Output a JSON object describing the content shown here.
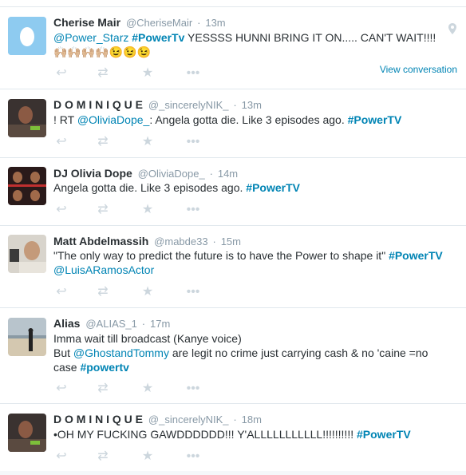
{
  "tweets": [
    {
      "fullname": "Cherise Mair",
      "username": "@CheriseMair",
      "time": "13m",
      "mention1": "@Power_Starz",
      "hashtag1": "#PowerTv",
      "text1": " YESSSS HUNNI BRING IT ON..... CAN'T WAIT!!!! ",
      "emoji_line": "🙌🏼🙌🏼🙌🏼🙌🏼😉😉😉",
      "view_conversation": "View conversation",
      "avatar": "default-egg-avatar",
      "geo_icon": "location-pin-icon"
    },
    {
      "fullname": "D O M I N I Q U E",
      "username": "@_sincerelyNIK_",
      "time": "13m",
      "prefix": "! RT ",
      "mention1": "@OliviaDope_",
      "text1": ": Angela gotta die. Like 3 episodes ago. ",
      "hashtag1": "#PowerTV"
    },
    {
      "fullname": "DJ Olivia Dope",
      "username": "@OliviaDope_",
      "time": "14m",
      "text1": "Angela gotta die. Like 3 episodes ago. ",
      "hashtag1": "#PowerTV"
    },
    {
      "fullname": "Matt Abdelmassih",
      "username": "@mabde33",
      "time": "15m",
      "text1": "\"The only way to predict the future is to have the Power to shape it\" ",
      "hashtag1": "#PowerTV",
      "mention1": "@LuisARamosActor"
    },
    {
      "fullname": "Alias",
      "username": "@ALIAS_1",
      "time": "17m",
      "text1": "Imma wait till broadcast (Kanye voice)",
      "prefix2": "But ",
      "mention1": "@GhostandTommy",
      "text2": " are legit no crime just carrying cash & no 'caine =no case ",
      "hashtag1": "#powertv"
    },
    {
      "fullname": "D O M I N I Q U E",
      "username": "@_sincerelyNIK_",
      "time": "18m",
      "text1": "•OH MY FUCKING GAWDDDDDD!!! Y'ALLLLLLLLLLL!!!!!!!!!! ",
      "hashtag1": "#PowerTV"
    }
  ],
  "separator": "·",
  "action_icons": [
    "reply-icon",
    "retweet-icon",
    "favorite-icon",
    "more-icon"
  ],
  "colors": {
    "link": "#0084b4",
    "muted": "#8899a6",
    "icon": "#ccd6dd",
    "text": "#292f33",
    "border": "#e1e8ed"
  }
}
